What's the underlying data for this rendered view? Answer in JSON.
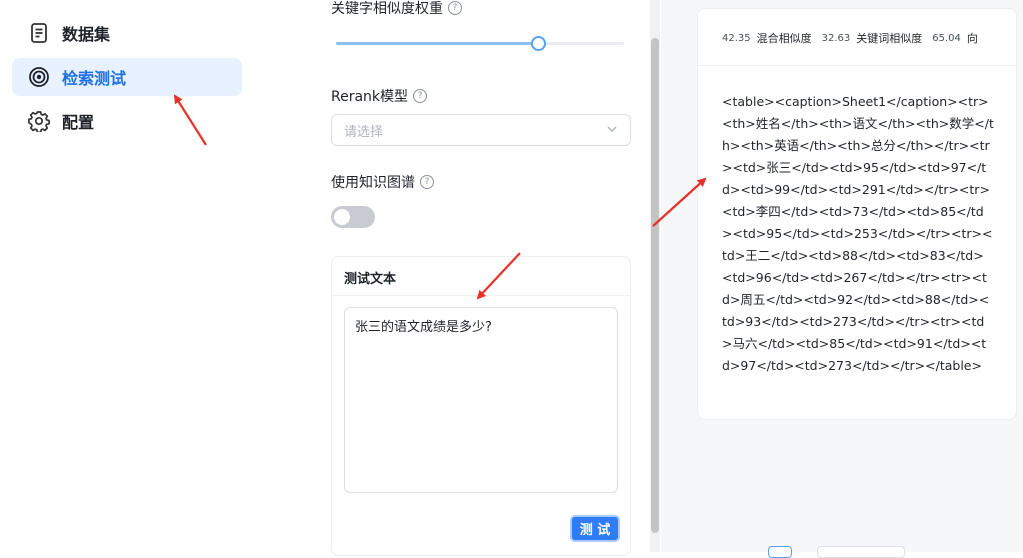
{
  "sidebar": {
    "items": [
      {
        "label": "数据集",
        "icon": "document-icon",
        "active": false
      },
      {
        "label": "检索测试",
        "icon": "target-icon",
        "active": true
      },
      {
        "label": "配置",
        "icon": "gear-icon",
        "active": false
      }
    ]
  },
  "settings": {
    "keyword_weight_label": "关键字相似度权重",
    "keyword_weight_value": 0.7,
    "rerank_label": "Rerank模型",
    "rerank_placeholder": "请选择",
    "knowledge_graph_label": "使用知识图谱",
    "knowledge_graph_enabled": false,
    "help_glyph": "?"
  },
  "test_panel": {
    "title": "测试文本",
    "text": "张三的语文成绩是多少?",
    "button_label": "测 试"
  },
  "result": {
    "scores": [
      {
        "value": "42.35",
        "label": "混合相似度"
      },
      {
        "value": "32.63",
        "label": "关键词相似度"
      },
      {
        "value": "65.04",
        "label": "向"
      }
    ],
    "content": "<table><caption>Sheet1</caption><tr><th>姓名</th><th>语文</th><th>数学</th><th>英语</th><th>总分</th></tr><tr><td>张三</td><td>95</td><td>97</td><td>99</td><td>291</td></tr><tr><td>李四</td><td>73</td><td>85</td><td>95</td><td>253</td></tr><tr><td>王二</td><td>88</td><td>83</td><td>96</td><td>267</td></tr><tr><td>周五</td><td>92</td><td>88</td><td>93</td><td>273</td></tr><tr><td>马六</td><td>85</td><td>91</td><td>97</td><td>273</td></tr></table>"
  },
  "colors": {
    "accent": "#1f6fe5",
    "active_bg": "#e8f1ff",
    "button": "#2f7cf6",
    "annotation_arrow": "#e8312b"
  }
}
